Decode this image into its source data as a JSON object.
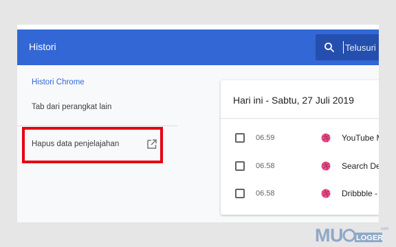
{
  "header": {
    "title": "Histori",
    "search_placeholder": "Telusuri h"
  },
  "sidebar": {
    "items": [
      {
        "label": "Histori Chrome"
      },
      {
        "label": "Tab dari perangkat lain"
      },
      {
        "label": "Hapus data penjelajahan"
      }
    ]
  },
  "history": {
    "date_heading": "Hari ini - Sabtu, 27 Juli 2019",
    "entries": [
      {
        "time": "06.59",
        "title": "YouTube M"
      },
      {
        "time": "06.58",
        "title": "Search De"
      },
      {
        "time": "06.58",
        "title": "Dribbble -"
      }
    ]
  },
  "watermark": {
    "brand": "MUGLOGER",
    "suffix": "com"
  },
  "colors": {
    "accent": "#3367d6",
    "highlight": "#e60012",
    "favicon": "#ea4c89"
  }
}
